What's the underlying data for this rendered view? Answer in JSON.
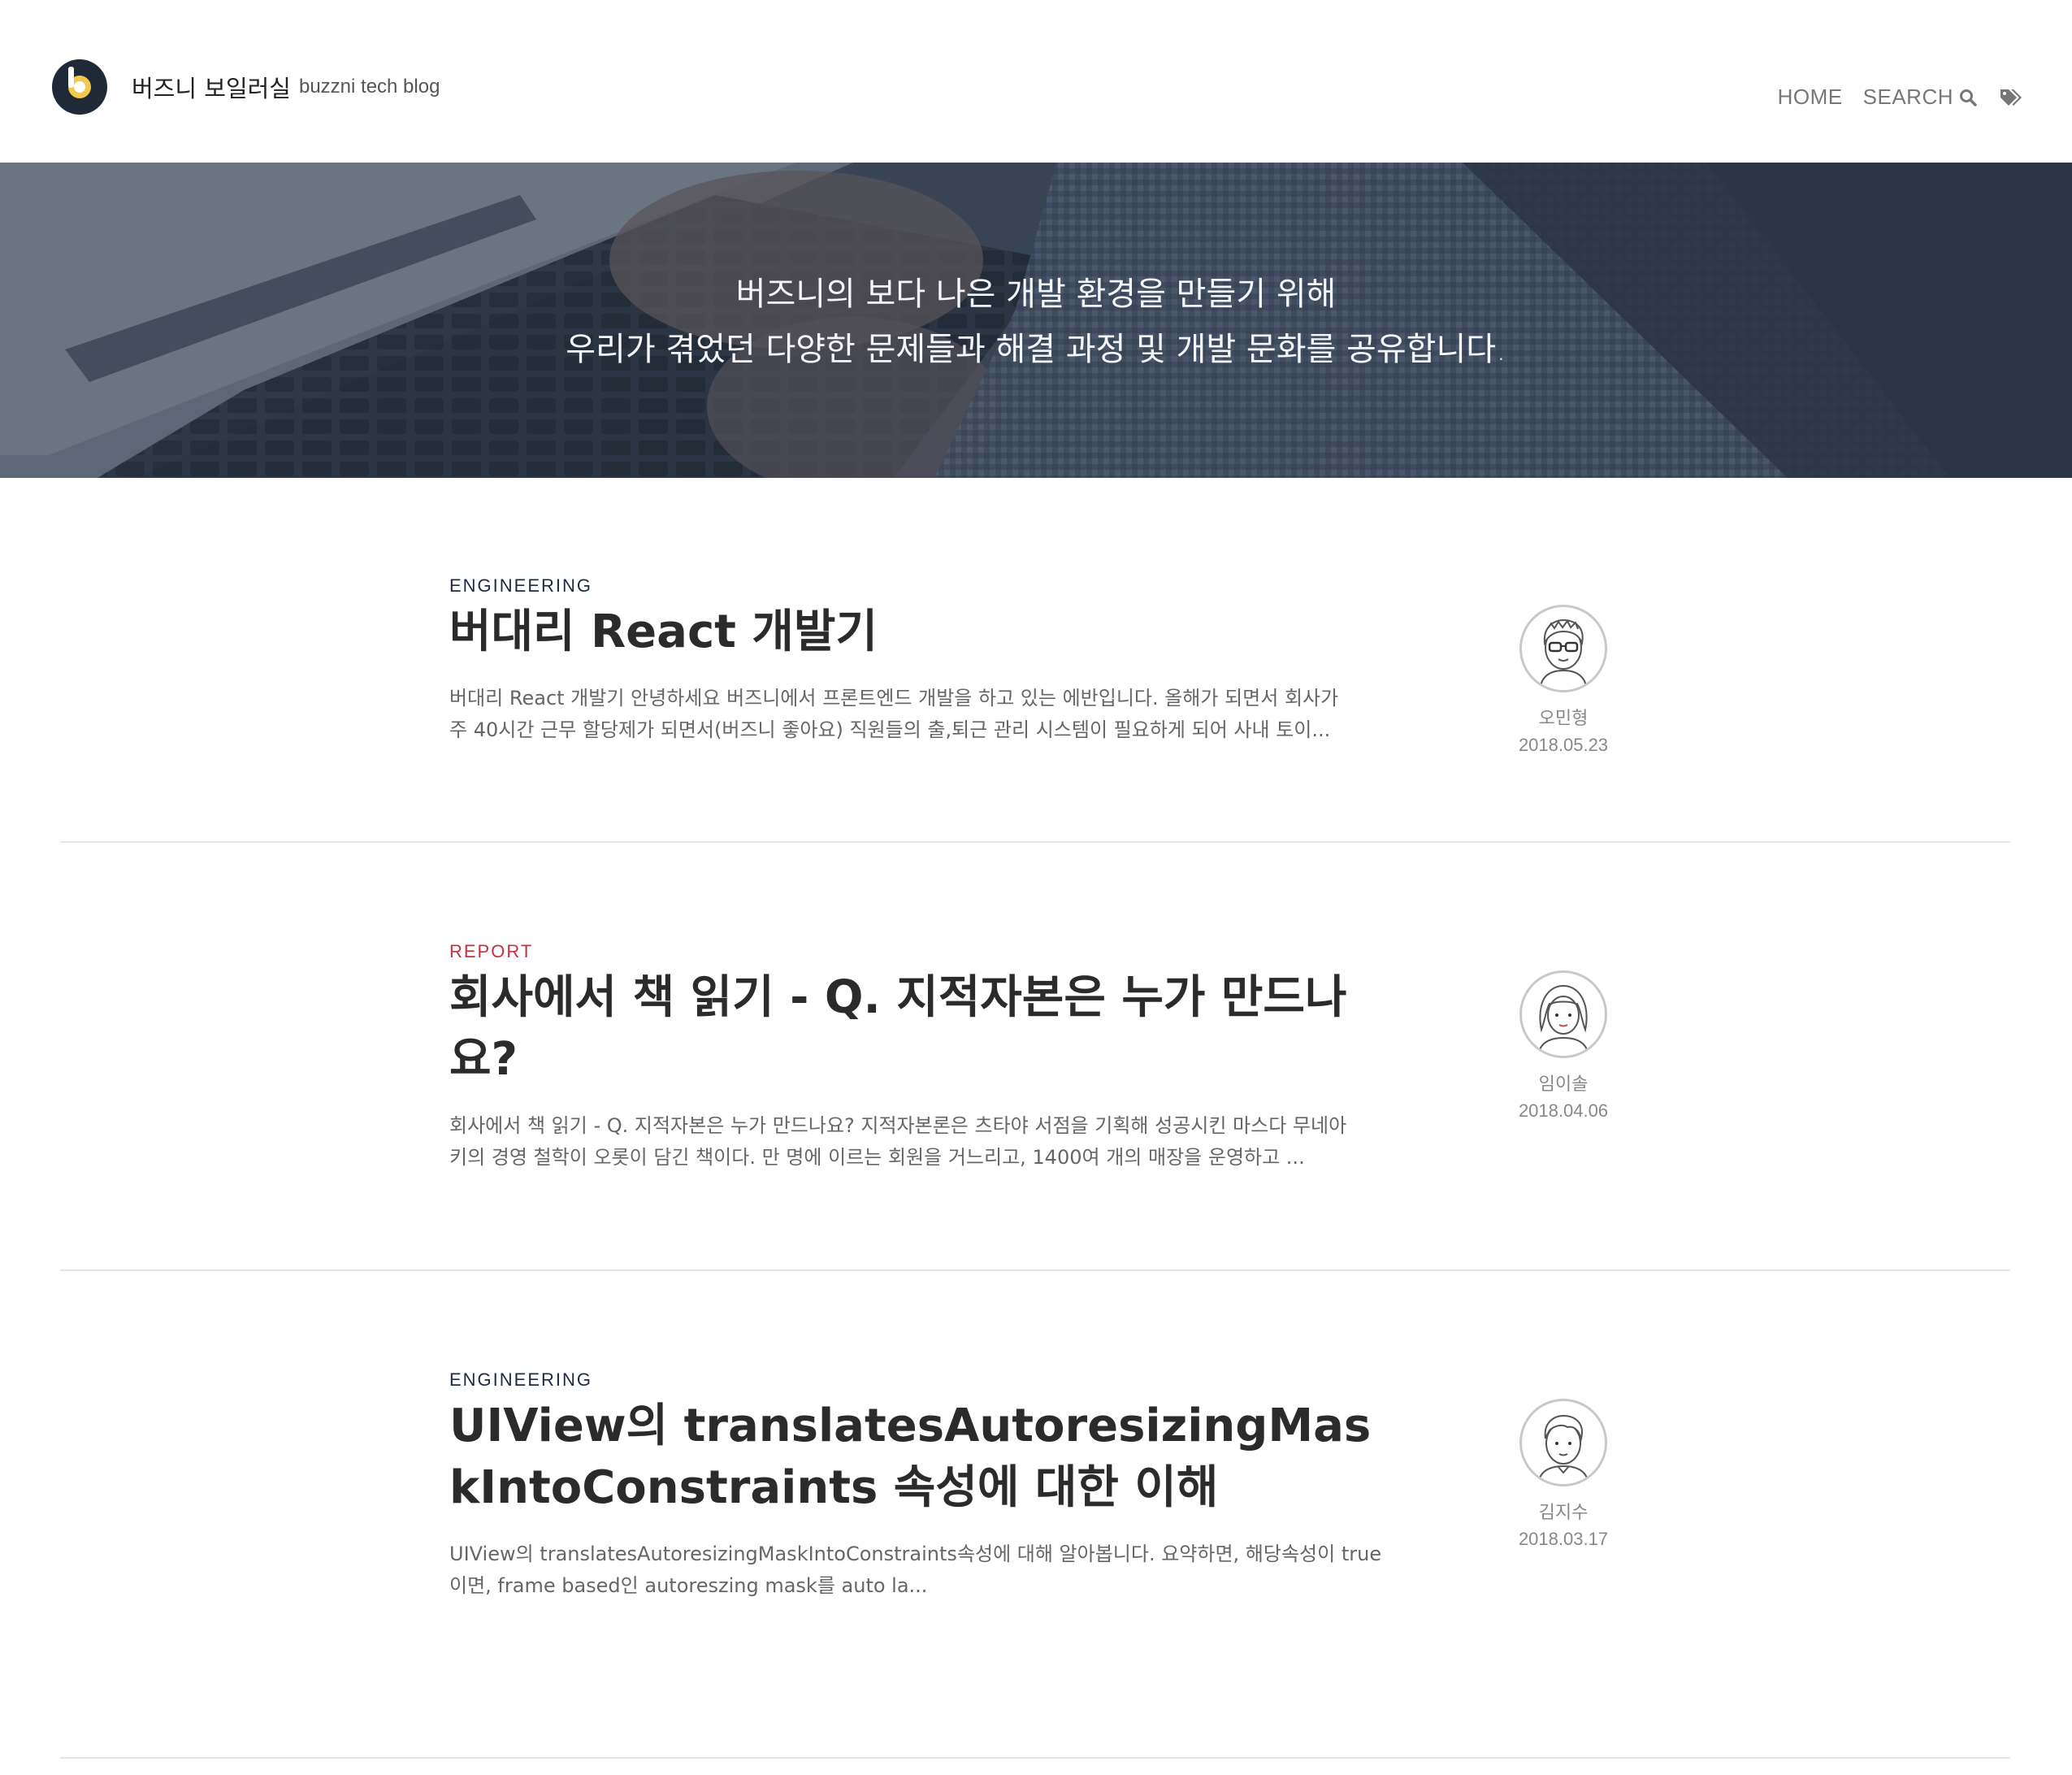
{
  "header": {
    "brand_name": "버즈니 보일러실",
    "brand_sub": "buzzni tech blog",
    "nav": {
      "home": "HOME",
      "search": "SEARCH"
    },
    "icons": {
      "logo": "buzzni-logo-icon",
      "search": "search-icon",
      "tags": "tags-icon"
    }
  },
  "hero": {
    "line1": "버즈니의 보다 나은 개발 환경을 만들기 위해",
    "line2": "우리가 겪었던 다양한 문제들과 해결 과정 및 개발 문화를 공유합니다."
  },
  "posts": [
    {
      "category": "ENGINEERING",
      "title": "버대리 React 개발기",
      "excerpt_line1": "버대리 React 개발기 안녕하세요 버즈니에서 프론트엔드 개발을 하고 있는 에반입니다. 올해가 되면서 회사가",
      "excerpt_line2": "주 40시간 근무 할당제가 되면서(버즈니 좋아요) 직원들의 출,퇴근 관리 시스템이 필요하게 되어 사내 토이...",
      "author": "오민형",
      "date": "2018.05.23"
    },
    {
      "category": "REPORT",
      "title": "회사에서 책 읽기 - Q. 지적자본은 누가 만드나요?",
      "excerpt_line1": "회사에서 책 읽기 - Q. 지적자본은 누가 만드나요? 지적자본론은 츠타야 서점을 기획해 성공시킨 마스다 무네아",
      "excerpt_line2": "키의 경영 철학이 오롯이 담긴 책이다. 만 명에 이르는 회원을 거느리고, 1400여 개의 매장을 운영하고 ...",
      "author": "임이솔",
      "date": "2018.04.06"
    },
    {
      "category": "ENGINEERING",
      "title": "UIView의 translatesAutoresizingMaskIntoConstraints 속성에 대한 이해",
      "excerpt_line1": "UIView의 translatesAutoresizingMaskIntoConstraints속성에 대해 알아봅니다. 요약하면, 해당속성이 true",
      "excerpt_line2": "이면, frame based인 autoreszing mask를 auto la...",
      "author": "김지수",
      "date": "2018.03.17"
    }
  ],
  "colors": {
    "hero_overlay": "#283242",
    "category_engineering": "#1f2a44",
    "category_report": "#c8303d",
    "divider": "#e6e6e6"
  }
}
